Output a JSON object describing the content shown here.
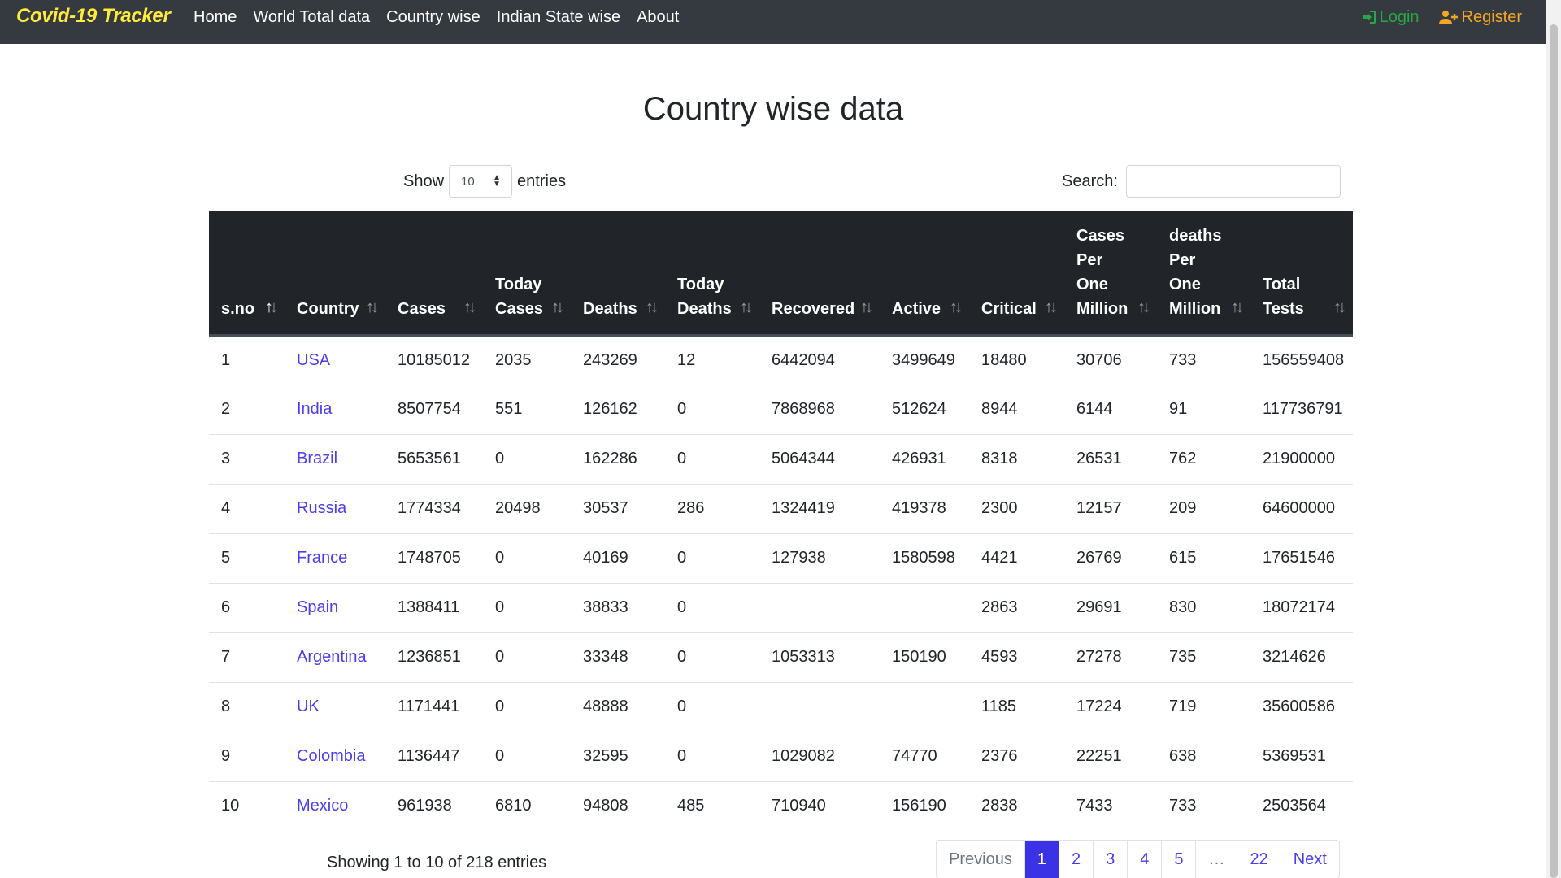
{
  "navbar": {
    "brand": "Covid-19 Tracker",
    "links": [
      "Home",
      "World Total data",
      "Country wise",
      "Indian State wise",
      "About"
    ],
    "login": "Login",
    "register": "Register",
    "colors": {
      "background": "#343a40",
      "brand": "#ffeb3b",
      "login": "#28a745",
      "register": "#f5a623"
    }
  },
  "page": {
    "title": "Country wise data"
  },
  "controls": {
    "show_label": "Show",
    "entries_label": "entries",
    "length_value": "10",
    "search_label": "Search:",
    "search_value": ""
  },
  "table": {
    "headers": [
      "s.no",
      "Country",
      "Cases",
      "Today Cases",
      "Deaths",
      "Today Deaths",
      "Recovered",
      "Active",
      "Critical",
      "Cases Per One Million",
      "deaths Per One Million",
      "Total Tests"
    ],
    "rows": [
      [
        "1",
        "USA",
        "10185012",
        "2035",
        "243269",
        "12",
        "6442094",
        "3499649",
        "18480",
        "30706",
        "733",
        "156559408"
      ],
      [
        "2",
        "India",
        "8507754",
        "551",
        "126162",
        "0",
        "7868968",
        "512624",
        "8944",
        "6144",
        "91",
        "117736791"
      ],
      [
        "3",
        "Brazil",
        "5653561",
        "0",
        "162286",
        "0",
        "5064344",
        "426931",
        "8318",
        "26531",
        "762",
        "21900000"
      ],
      [
        "4",
        "Russia",
        "1774334",
        "20498",
        "30537",
        "286",
        "1324419",
        "419378",
        "2300",
        "12157",
        "209",
        "64600000"
      ],
      [
        "5",
        "France",
        "1748705",
        "0",
        "40169",
        "0",
        "127938",
        "1580598",
        "4421",
        "26769",
        "615",
        "17651546"
      ],
      [
        "6",
        "Spain",
        "1388411",
        "0",
        "38833",
        "0",
        "",
        "",
        "2863",
        "29691",
        "830",
        "18072174"
      ],
      [
        "7",
        "Argentina",
        "1236851",
        "0",
        "33348",
        "0",
        "1053313",
        "150190",
        "4593",
        "27278",
        "735",
        "3214626"
      ],
      [
        "8",
        "UK",
        "1171441",
        "0",
        "48888",
        "0",
        "",
        "",
        "1185",
        "17224",
        "719",
        "35600586"
      ],
      [
        "9",
        "Colombia",
        "1136447",
        "0",
        "32595",
        "0",
        "1029082",
        "74770",
        "2376",
        "22251",
        "638",
        "5369531"
      ],
      [
        "10",
        "Mexico",
        "961938",
        "6810",
        "94808",
        "485",
        "710940",
        "156190",
        "2838",
        "7433",
        "733",
        "2503564"
      ]
    ]
  },
  "footer": {
    "info": "Showing 1 to 10 of 218 entries",
    "pagination": {
      "previous": "Previous",
      "pages": [
        "1",
        "2",
        "3",
        "4",
        "5",
        "…",
        "22"
      ],
      "active": "1",
      "next": "Next"
    }
  }
}
